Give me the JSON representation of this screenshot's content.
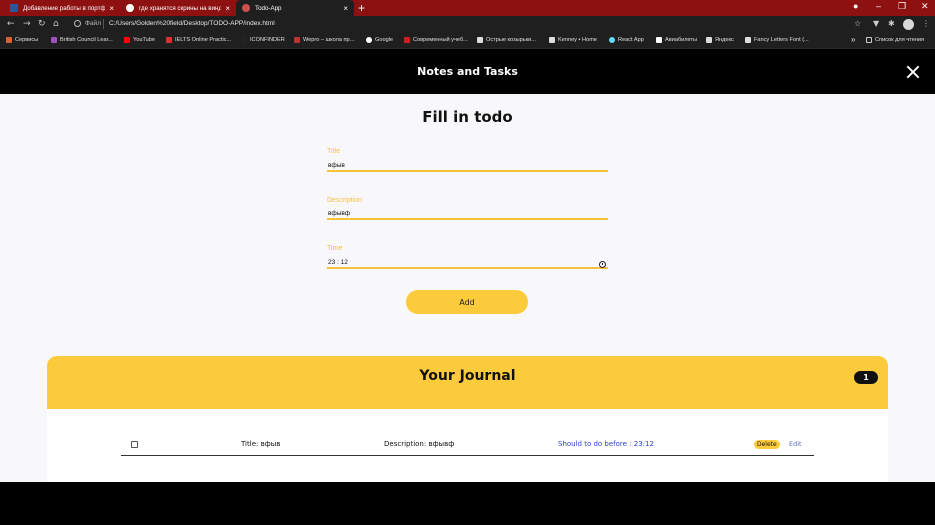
{
  "browser": {
    "tabs": [
      {
        "title": "Добавление работы в портфол...",
        "icon_color": "#2b579a",
        "active": false
      },
      {
        "title": "где хранятся скрины на виндо...",
        "icon_color": "#ffffff",
        "active": false
      },
      {
        "title": "Todo-App",
        "icon_color": "#d05050",
        "active": true
      }
    ],
    "new_tab": "+",
    "address": {
      "scheme_label": "Файл",
      "url": "C:/Users/Golden%20field/Desktop/TODO-APP/index.html"
    },
    "bookmarks": [
      {
        "label": "Сервисы",
        "icon_color": "#e06030"
      },
      {
        "label": "British Council Lear...",
        "icon_color": "#a050c0"
      },
      {
        "label": "YouTube",
        "icon_color": "#ff0000"
      },
      {
        "label": "IELTS Online Practic...",
        "icon_color": "#e03030"
      },
      {
        "label": "ICONFINDER",
        "icon_color": "#222222"
      },
      {
        "label": "Wepro – школа пр...",
        "icon_color": "#c03030"
      },
      {
        "label": "Google",
        "icon_color": "#ffffff"
      },
      {
        "label": "Современный учеб...",
        "icon_color": "#cc2020"
      },
      {
        "label": "Острые козырьки...",
        "icon_color": "#dddddd"
      },
      {
        "label": "Kenney • Home",
        "icon_color": "#dddddd"
      },
      {
        "label": "React App",
        "icon_color": "#61dafb"
      },
      {
        "label": "Авиабилеты",
        "icon_color": "#ffffff"
      },
      {
        "label": "Яндекс",
        "icon_color": "#dddddd"
      },
      {
        "label": "Fancy Letters Font (...",
        "icon_color": "#dddddd"
      }
    ],
    "more_bookmarks": "»",
    "reading_list": "Список для чтения"
  },
  "header": {
    "title": "Notes and Tasks"
  },
  "form": {
    "heading": "Fill in todo",
    "title_label": "Title",
    "title_value": "вфыв",
    "description_label": "Description",
    "description_value": "вфывф",
    "time_label": "Time",
    "time_value": "23 : 12",
    "add_label": "Add"
  },
  "journal": {
    "heading": "Your Journal",
    "count": "1",
    "items": [
      {
        "title": "Title: вфыв",
        "description": "Description: вфывф",
        "deadline": "Should to do before : 23:12",
        "checked": false
      }
    ],
    "delete_label": "Delete",
    "edit_label": "Edit"
  },
  "colors": {
    "accent": "#fccb3c",
    "label": "#f6c040",
    "deadline": "#2a3fd4",
    "tab_strip": "#8e1111"
  }
}
